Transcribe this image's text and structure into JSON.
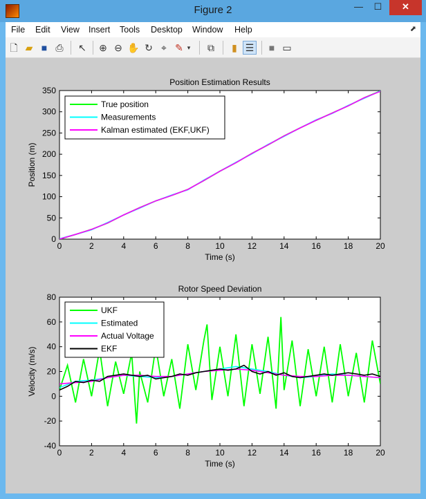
{
  "window": {
    "title": "Figure 2",
    "minimize_glyph": "—",
    "maximize_glyph": "☐",
    "close_glyph": "✕"
  },
  "menu": [
    "File",
    "Edit",
    "View",
    "Insert",
    "Tools",
    "Desktop",
    "Window",
    "Help"
  ],
  "toolbar": [
    "new-figure-icon",
    "open-icon",
    "save-icon",
    "print-icon",
    "pointer-icon",
    "zoom-in-icon",
    "zoom-out-icon",
    "pan-icon",
    "rotate-icon",
    "data-cursor-icon",
    "brush-icon",
    "dropdown-arrow-icon",
    "link-icon",
    "colorbar-icon",
    "legend-icon",
    "hide-tools-icon",
    "dock-icon"
  ],
  "colors": {
    "green": "#00ff00",
    "cyan": "#00ffff",
    "magenta": "#ff00ff",
    "black": "#000000",
    "figure_bg": "#cccccc"
  },
  "chart_data": [
    {
      "type": "line",
      "title": "Position Estimation Results",
      "xlabel": "Time (s)",
      "ylabel": "Position (m)",
      "xlim": [
        0,
        20
      ],
      "ylim": [
        0,
        350
      ],
      "xticks": [
        0,
        2,
        4,
        6,
        8,
        10,
        12,
        14,
        16,
        18,
        20
      ],
      "yticks": [
        0,
        50,
        100,
        150,
        200,
        250,
        300,
        350
      ],
      "legend_position": "top-left",
      "series": [
        {
          "name": "True position",
          "color": "#00ff00",
          "x": [
            0,
            1,
            2,
            3,
            4,
            5,
            6,
            7,
            8,
            9,
            10,
            11,
            12,
            13,
            14,
            15,
            16,
            17,
            18,
            19,
            20
          ],
          "y": [
            0,
            11,
            23,
            38,
            57,
            74,
            90,
            103,
            117,
            138,
            160,
            180,
            202,
            222,
            243,
            262,
            280,
            297,
            314,
            333,
            349
          ]
        },
        {
          "name": "Measurements",
          "color": "#00ffff",
          "x": [
            0,
            1,
            2,
            3,
            4,
            5,
            6,
            7,
            8,
            9,
            10,
            11,
            12,
            13,
            14,
            15,
            16,
            17,
            18,
            19,
            20
          ],
          "y": [
            1,
            11,
            22,
            39,
            57,
            73,
            90,
            104,
            116,
            139,
            160,
            181,
            201,
            223,
            242,
            262,
            281,
            296,
            315,
            332,
            349
          ]
        },
        {
          "name": "Kalman estimated (EKF,UKF)",
          "color": "#ff00ff",
          "x": [
            0,
            1,
            2,
            3,
            4,
            5,
            6,
            7,
            8,
            9,
            10,
            11,
            12,
            13,
            14,
            15,
            16,
            17,
            18,
            19,
            20
          ],
          "y": [
            0,
            11,
            23,
            38,
            57,
            74,
            90,
            103,
            117,
            138,
            160,
            180,
            202,
            222,
            243,
            262,
            280,
            297,
            314,
            333,
            348
          ]
        }
      ]
    },
    {
      "type": "line",
      "title": "Rotor Speed Deviation",
      "xlabel": "Time (s)",
      "ylabel": "Velocity (m/s)",
      "xlim": [
        0,
        20
      ],
      "ylim": [
        -40,
        80
      ],
      "xticks": [
        0,
        2,
        4,
        6,
        8,
        10,
        12,
        14,
        16,
        18,
        20
      ],
      "yticks": [
        -40,
        -20,
        0,
        20,
        40,
        60,
        80
      ],
      "legend_position": "top-left",
      "series": [
        {
          "name": "UKF",
          "color": "#00ff00",
          "x": [
            0,
            0.5,
            1,
            1.5,
            2,
            2.5,
            3,
            3.5,
            4,
            4.5,
            4.8,
            5,
            5.5,
            6,
            6.5,
            7,
            7.5,
            8,
            8.5,
            9,
            9.2,
            9.5,
            10,
            10.5,
            11,
            11.5,
            12,
            12.5,
            13,
            13.5,
            13.8,
            14,
            14.5,
            15,
            15.5,
            16,
            16.5,
            17,
            17.5,
            18,
            18.5,
            19,
            19.5,
            20
          ],
          "y": [
            5,
            25,
            -5,
            30,
            0,
            38,
            -8,
            28,
            2,
            35,
            -22,
            20,
            -5,
            40,
            0,
            30,
            -10,
            42,
            5,
            45,
            58,
            -3,
            40,
            0,
            50,
            -8,
            42,
            2,
            48,
            -10,
            64,
            5,
            45,
            -8,
            38,
            0,
            40,
            -5,
            42,
            0,
            35,
            -5,
            45,
            10
          ]
        },
        {
          "name": "Estimated",
          "color": "#00ffff",
          "x": [
            0,
            1,
            2,
            3,
            4,
            5,
            6,
            7,
            8,
            9,
            10,
            11,
            12,
            13,
            14,
            15,
            16,
            17,
            18,
            19,
            20
          ],
          "y": [
            7,
            12,
            13,
            15,
            17,
            16,
            15,
            16,
            18,
            20,
            22,
            24,
            22,
            20,
            17,
            15,
            16,
            18,
            17,
            16,
            15
          ]
        },
        {
          "name": "Actual Voltage",
          "color": "#ff00ff",
          "x": [
            0,
            1,
            2,
            3,
            4,
            5,
            6,
            7,
            8,
            9,
            10,
            11,
            12,
            13,
            14,
            15,
            16,
            17,
            18,
            19,
            20
          ],
          "y": [
            10,
            11,
            12,
            15,
            17,
            17,
            16,
            16,
            18,
            20,
            21,
            22,
            21,
            19,
            17,
            16,
            16,
            17,
            17,
            16,
            15
          ]
        },
        {
          "name": "EKF",
          "color": "#000000",
          "x": [
            0,
            0.5,
            1,
            1.5,
            2,
            2.5,
            3,
            3.5,
            4,
            4.5,
            5,
            5.5,
            6,
            6.5,
            7,
            7.5,
            8,
            8.5,
            9,
            9.5,
            10,
            10.5,
            11,
            11.5,
            12,
            12.5,
            13,
            13.5,
            14,
            14.5,
            15,
            15.5,
            16,
            16.5,
            17,
            17.5,
            18,
            18.5,
            19,
            19.5,
            20
          ],
          "y": [
            5,
            8,
            12,
            11,
            13,
            12,
            16,
            17,
            18,
            17,
            16,
            17,
            14,
            15,
            16,
            18,
            17,
            19,
            20,
            21,
            22,
            21,
            22,
            25,
            20,
            18,
            20,
            17,
            19,
            16,
            15,
            16,
            17,
            18,
            17,
            18,
            19,
            18,
            17,
            18,
            16
          ]
        }
      ]
    }
  ]
}
